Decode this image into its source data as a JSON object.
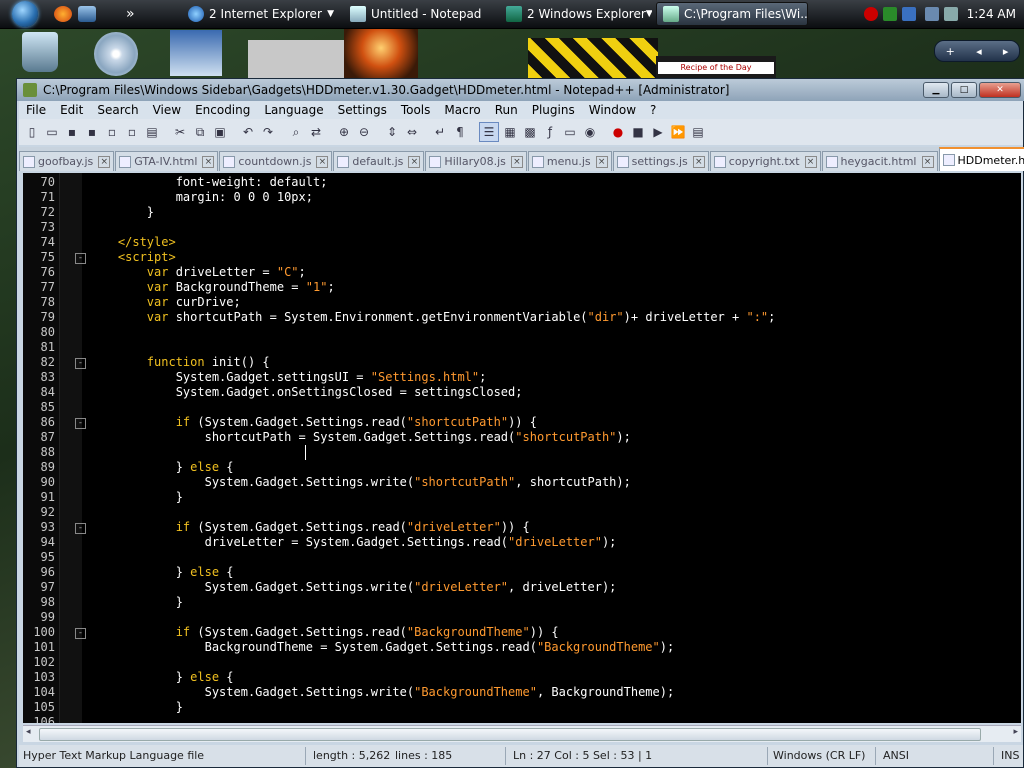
{
  "taskbar": {
    "buttons": [
      {
        "label": "2 Internet Explorer",
        "has_menu": true
      },
      {
        "label": "Untitled - Notepad",
        "has_menu": false
      },
      {
        "label": "2 Windows Explorer",
        "has_menu": true
      },
      {
        "label": "C:\\Program Files\\Wi...",
        "has_menu": false
      }
    ],
    "overflow": "»",
    "clock": "1:24 AM"
  },
  "desktop": {
    "sidebar_controls": [
      "+",
      "◂",
      "▸"
    ],
    "recipe_text": "Recipe of the Day"
  },
  "window": {
    "title": "C:\\Program Files\\Windows Sidebar\\Gadgets\\HDDmeter.v1.30.Gadget\\HDDmeter.html - Notepad++ [Administrator]",
    "controls": {
      "minimize": "▁",
      "maximize": "□",
      "close": "✕"
    }
  },
  "menu": [
    "File",
    "Edit",
    "Search",
    "View",
    "Encoding",
    "Language",
    "Settings",
    "Tools",
    "Macro",
    "Run",
    "Plugins",
    "Window",
    "?"
  ],
  "tabs": [
    "goofbay.js",
    "GTA-IV.html",
    "countdown.js",
    "default.js",
    "Hillary08.js",
    "menu.js",
    "settings.js",
    "copyright.txt",
    "heygacit.html",
    "HDDmeter.html"
  ],
  "active_tab": "HDDmeter.html",
  "code_lines": [
    {
      "n": "70",
      "fold": "",
      "html": "            font-weight: default;"
    },
    {
      "n": "71",
      "fold": "",
      "html": "            margin: 0 0 0 10px;"
    },
    {
      "n": "72",
      "fold": "",
      "html": "        }"
    },
    {
      "n": "73",
      "fold": "",
      "html": ""
    },
    {
      "n": "74",
      "fold": "",
      "html": "    <span class=\"tag\">&lt;/style&gt;</span>"
    },
    {
      "n": "75",
      "fold": "-",
      "html": "    <span class=\"tag\">&lt;script&gt;</span>"
    },
    {
      "n": "76",
      "fold": "",
      "html": "        <span class=\"kw\">var</span> driveLetter = <span class=\"str\">\"C\"</span>;"
    },
    {
      "n": "77",
      "fold": "",
      "html": "        <span class=\"kw\">var</span> BackgroundTheme = <span class=\"str\">\"1\"</span>;"
    },
    {
      "n": "78",
      "fold": "",
      "html": "        <span class=\"kw\">var</span> curDrive;"
    },
    {
      "n": "79",
      "fold": "",
      "html": "        <span class=\"kw\">var</span> shortcutPath = System.Environment.getEnvironmentVariable(<span class=\"str\">\"dir\"</span>)+ driveLetter + <span class=\"str\">\":\"</span>;"
    },
    {
      "n": "80",
      "fold": "",
      "html": ""
    },
    {
      "n": "81",
      "fold": "",
      "html": ""
    },
    {
      "n": "82",
      "fold": "-",
      "html": "        <span class=\"kw\">function</span> init() {"
    },
    {
      "n": "83",
      "fold": "",
      "html": "            System.Gadget.settingsUI = <span class=\"str\">\"Settings.html\"</span>;"
    },
    {
      "n": "84",
      "fold": "",
      "html": "            System.Gadget.onSettingsClosed = settingsClosed;"
    },
    {
      "n": "85",
      "fold": "",
      "html": ""
    },
    {
      "n": "86",
      "fold": "-",
      "html": "            <span class=\"kw\">if</span> (System.Gadget.Settings.read(<span class=\"str\">\"shortcutPath\"</span>)) {"
    },
    {
      "n": "87",
      "fold": "",
      "html": "                shortcutPath = System.Gadget.Settings.read(<span class=\"str\">\"shortcutPath\"</span>);"
    },
    {
      "n": "88",
      "fold": "",
      "html": ""
    },
    {
      "n": "89",
      "fold": "",
      "html": "            } <span class=\"kw\">else</span> {"
    },
    {
      "n": "90",
      "fold": "",
      "html": "                System.Gadget.Settings.write(<span class=\"str\">\"shortcutPath\"</span>, shortcutPath);"
    },
    {
      "n": "91",
      "fold": "",
      "html": "            }"
    },
    {
      "n": "92",
      "fold": "",
      "html": ""
    },
    {
      "n": "93",
      "fold": "-",
      "html": "            <span class=\"kw\">if</span> (System.Gadget.Settings.read(<span class=\"str\">\"driveLetter\"</span>)) {"
    },
    {
      "n": "94",
      "fold": "",
      "html": "                driveLetter = System.Gadget.Settings.read(<span class=\"str\">\"driveLetter\"</span>);"
    },
    {
      "n": "95",
      "fold": "",
      "html": ""
    },
    {
      "n": "96",
      "fold": "",
      "html": "            } <span class=\"kw\">else</span> {"
    },
    {
      "n": "97",
      "fold": "",
      "html": "                System.Gadget.Settings.write(<span class=\"str\">\"driveLetter\"</span>, driveLetter);"
    },
    {
      "n": "98",
      "fold": "",
      "html": "            }"
    },
    {
      "n": "99",
      "fold": "",
      "html": ""
    },
    {
      "n": "100",
      "fold": "-",
      "html": "            <span class=\"kw\">if</span> (System.Gadget.Settings.read(<span class=\"str\">\"BackgroundTheme\"</span>)) {"
    },
    {
      "n": "101",
      "fold": "",
      "html": "                BackgroundTheme = System.Gadget.Settings.read(<span class=\"str\">\"BackgroundTheme\"</span>);"
    },
    {
      "n": "102",
      "fold": "",
      "html": ""
    },
    {
      "n": "103",
      "fold": "",
      "html": "            } <span class=\"kw\">else</span> {"
    },
    {
      "n": "104",
      "fold": "",
      "html": "                System.Gadget.Settings.write(<span class=\"str\">\"BackgroundTheme\"</span>, BackgroundTheme);"
    },
    {
      "n": "105",
      "fold": "",
      "html": "            }"
    },
    {
      "n": "106",
      "fold": "",
      "html": ""
    }
  ],
  "status": {
    "file_type": "Hyper Text Markup Language file",
    "length": "length : 5,262",
    "lines": "lines : 185",
    "position": "Ln : 27    Col : 5    Sel : 53 | 1",
    "eol": "Windows (CR LF)",
    "encoding": "ANSI",
    "mode": "INS"
  },
  "colors": {
    "editor_bg": "#000000",
    "keyword": "#f0c020",
    "string": "#ff9a30",
    "text": "#ffffff"
  }
}
